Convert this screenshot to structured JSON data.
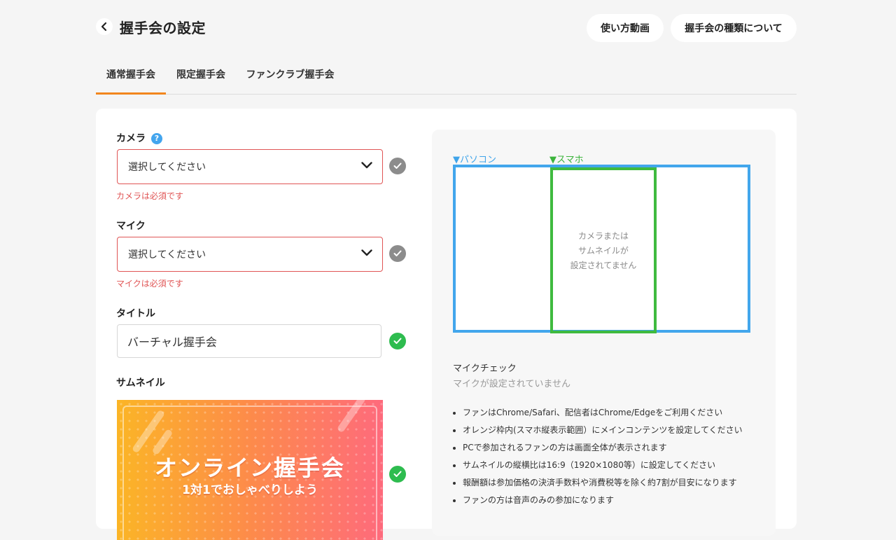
{
  "header": {
    "title": "握手会の設定",
    "how_to_video": "使い方動画",
    "about_types": "握手会の種類について"
  },
  "tabs": [
    {
      "label": "通常握手会",
      "active": true
    },
    {
      "label": "限定握手会",
      "active": false
    },
    {
      "label": "ファンクラブ握手会",
      "active": false
    }
  ],
  "form": {
    "camera": {
      "label": "カメラ",
      "help": "?",
      "value": "選択してください",
      "error": "カメラは必須です",
      "status": "incomplete"
    },
    "mic": {
      "label": "マイク",
      "value": "選択してください",
      "error": "マイクは必須です",
      "status": "incomplete"
    },
    "title": {
      "label": "タイトル",
      "value": "バーチャル握手会",
      "status": "complete"
    },
    "thumbnail": {
      "label": "サムネイル",
      "image_title": "オンライン握手会",
      "image_subtitle": "1対1でおしゃべりしよう",
      "status": "complete"
    }
  },
  "preview": {
    "pc_label": "▼パソコン",
    "sp_label": "▼スマホ",
    "no_camera_lines": [
      "カメラまたは",
      "サムネイルが",
      "設定されてません"
    ],
    "pc_color": "#42a6ec",
    "sp_color": "#3fba3f"
  },
  "mic_check": {
    "title": "マイクチェック",
    "status": "マイクが設定されていません"
  },
  "notes": [
    "ファンはChrome/Safari、配信者はChrome/Edgeをご利用ください",
    "オレンジ枠内(スマホ縦表示範囲）にメインコンテンツを設定してください",
    "PCで参加されるファンの方は画面全体が表示されます",
    "サムネイルの縦横比は16:9（1920×1080等）に設定してください",
    "報酬額は参加価格の決済手数料や消費税等を除く約7割が目安になります",
    "ファンの方は音声のみの参加になります"
  ],
  "colors": {
    "accent": "#f2861e",
    "error": "#e05555",
    "success": "#2ebc4f",
    "help": "#43a5ee"
  }
}
